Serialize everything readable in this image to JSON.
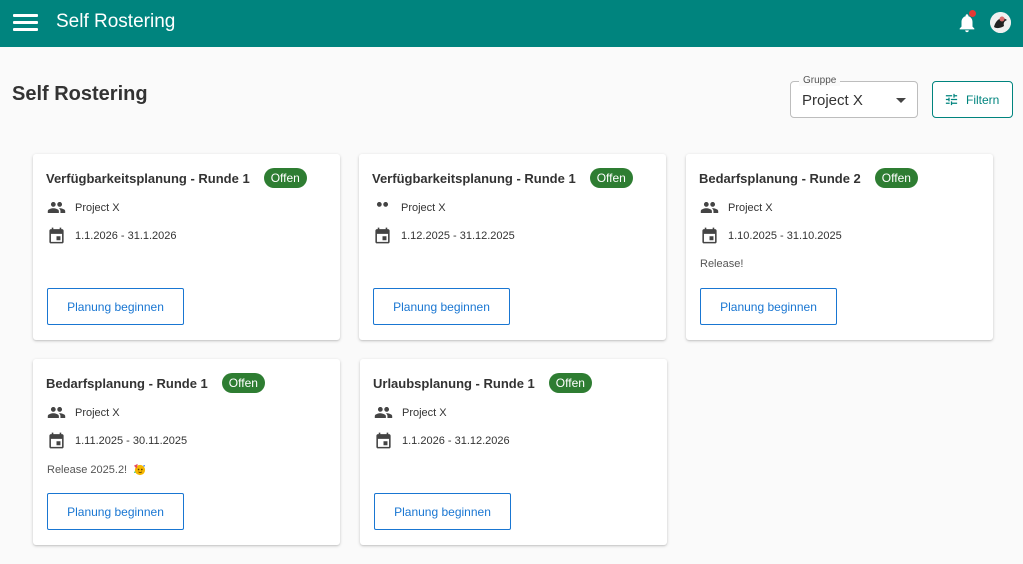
{
  "appbar": {
    "title": "Self Rostering",
    "menu_icon": "hamburger-menu-icon",
    "bell_icon": "notification-bell-icon",
    "avatar_icon": "user-avatar-icon",
    "color": "#00847e"
  },
  "page": {
    "title": "Self Rostering"
  },
  "group_select": {
    "label": "Gruppe",
    "value": "Project X"
  },
  "filter_button": {
    "label": "Filtern",
    "icon": "tune-icon"
  },
  "colors": {
    "badge": "#2e7d32",
    "button": "#1976d2"
  },
  "cards": [
    {
      "title": "Verfügbarkeitsplanung - Runde 1",
      "status": "Offen",
      "group": "Project X",
      "dates": "1.1.2026 - 31.1.2026",
      "note": "",
      "button": "Planung beginnen"
    },
    {
      "title": "Verfügbarkeitsplanung - Runde 1",
      "status": "Offen",
      "group": "Project X",
      "dates": "1.12.2025 - 31.12.2025",
      "note": "",
      "button": "Planung beginnen"
    },
    {
      "title": "Bedarfsplanung - Runde 2",
      "status": "Offen",
      "group": "Project X",
      "dates": "1.10.2025 - 31.10.2025",
      "note": "Release!",
      "button": "Planung beginnen"
    },
    {
      "title": "Bedarfsplanung - Runde 1",
      "status": "Offen",
      "group": "Project X",
      "dates": "1.11.2025 - 30.11.2025",
      "note": "Release 2025.2!",
      "note_icon": "party-face-emoji-icon",
      "button": "Planung beginnen"
    },
    {
      "title": "Urlaubsplanung - Runde 1",
      "status": "Offen",
      "group": "Project X",
      "dates": "1.1.2026 - 31.12.2026",
      "note": "",
      "button": "Planung beginnen"
    }
  ]
}
